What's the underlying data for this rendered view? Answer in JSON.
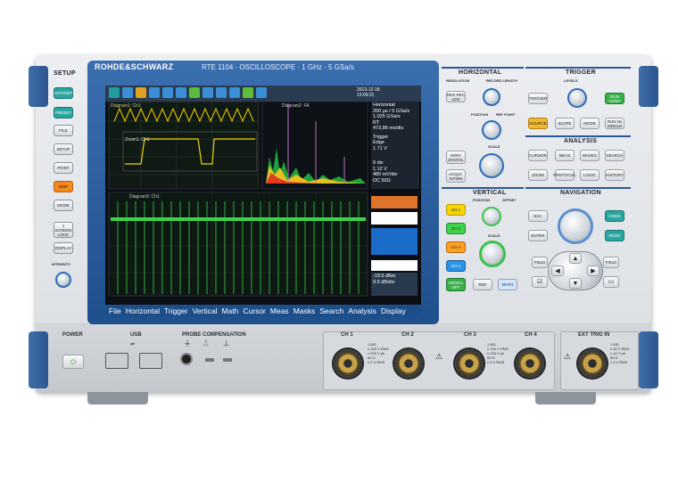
{
  "brand": {
    "name": "ROHDE&SCHWARZ",
    "model": "RTE 1104 · OSCILLOSCOPE · 1 GHz · 5 GSa/s"
  },
  "setup": {
    "title": "SETUP",
    "buttons": [
      "AUTOSET",
      "PRESET",
      "FILE",
      "SETUP",
      "PRINT",
      "DISP",
      "MODE",
      "1 SCREEN LOCK",
      "DISPLAY"
    ],
    "intensity": "INTENSITY"
  },
  "screen": {
    "diagram1": "Diagram1: Ch1",
    "zoom": "Zoom1: Ch1",
    "diagram2": "Diagram2: FA",
    "diagram3": "Diagram3: Ch1",
    "datetime": "2013-12-18 13:09:31",
    "horizontal_title": "Horizontal",
    "horizontal_values": [
      "200 µs / 5 GSa/s",
      "1.025 GSa/s",
      "RT",
      "473.86 ms/div"
    ],
    "trigger_title": "Trigger",
    "trigger_values": [
      "Edge",
      "1 71 V"
    ],
    "spectrum_values": [
      "0 div",
      "1.12 V",
      "480 mV/div",
      "DC 50Ω"
    ],
    "level_value": "-19.5 dBm",
    "level_values2": [
      "9.5 dB/div"
    ],
    "menu": [
      "File",
      "Horizontal",
      "Trigger",
      "Vertical",
      "Math",
      "Cursor",
      "Meas",
      "Masks",
      "Search",
      "Analysis",
      "Display"
    ]
  },
  "horizontal": {
    "title": "HORIZONTAL",
    "resolution": "RESOLUTION",
    "record_length": "RECORD LENGTH",
    "res_rec": "RES REC LEN",
    "position": "POSITION",
    "ref_point": "REF POINT",
    "scale": "SCALE",
    "horizontal_btn": "HORI- ZONTAL",
    "acquisition": "ACQUI- SITION"
  },
  "trigger": {
    "title": "TRIGGER",
    "levels": "LEVELS",
    "buttons": [
      "TRIGGER",
      "RUN CONT",
      "SOURCE",
      "SLOPE",
      "MODE",
      "RUN Nx SINGLE"
    ]
  },
  "analysis": {
    "title": "ANALYSIS",
    "buttons": [
      "CURSOR",
      "MEAS",
      "MASKS",
      "SEARCH",
      "ZOOM",
      "PROTOCOL",
      "LOGIC",
      "HISTORY"
    ]
  },
  "vertical": {
    "title": "VERTICAL",
    "position": "POSITION",
    "offset": "OFFSET",
    "scale": "SCALE",
    "channels": [
      "CH 1",
      "CH 2",
      "CH 3",
      "CH 4"
    ],
    "signal_off": "SIGNAL OFF",
    "ref": "REF",
    "math": "MATH"
  },
  "navigation": {
    "title": "NAVIGATION",
    "esc": "ESC",
    "enter": "ENTER",
    "undo": "UNDO",
    "redo": "REDO",
    "field_left": "FIELD",
    "field_right": "FIELD"
  },
  "front": {
    "power": "POWER",
    "usb": "USB",
    "probe": "PROBE COMPENSATION",
    "inputs": [
      "CH 1",
      "CH 2",
      "CH 3",
      "CH 4"
    ],
    "ext": "EXT TRIG IN",
    "spec_a": [
      "1 MΩ",
      "≤ 150 V RMS",
      "≤ 200 V pk",
      "50 Ω",
      "≤ 5 V RMS"
    ],
    "spec_ext": [
      "1 MΩ",
      "≤ 30 V RMS",
      "≤ 42 V pk",
      "50 Ω",
      "≤ 5 V RMS"
    ]
  },
  "colors": {
    "ch1": "#f5d400",
    "ch2": "#3cd34a",
    "ch3": "#ff8c1a",
    "ch4": "#2a95e8",
    "accent": "#1f5597"
  }
}
